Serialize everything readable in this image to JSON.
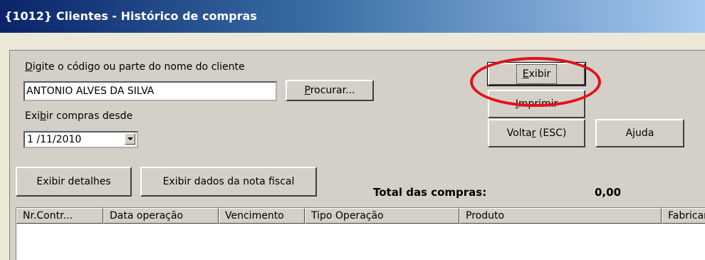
{
  "window": {
    "title": "{1012} Clientes - Histórico de compras"
  },
  "customer_search": {
    "label_prefix": "D",
    "label_rest": "igite o código ou parte do nome do cliente",
    "value": "ANTONIO ALVES DA SILVA",
    "search_prefix": "P",
    "search_rest": "rocurar..."
  },
  "since": {
    "label_pre": "Exi",
    "label_ul": "b",
    "label_post": "ir compras desde",
    "date": "1 /11/2010"
  },
  "actions": {
    "show_ul": "E",
    "show_rest": "xibir",
    "print_ul": "I",
    "print_rest": "mprimir",
    "back_pre": "Volta",
    "back_ul": "r",
    "back_post": " (ESC)",
    "help": "Ajuda"
  },
  "detail_buttons": {
    "details": "Exibir detalhes",
    "invoice": "Exibir dados da nota fiscal"
  },
  "totals": {
    "label": "Total das compras:",
    "value": "0,00"
  },
  "grid": {
    "columns": [
      "Nr.Contr...",
      "Data operação",
      "Vencimento",
      "Tipo Operação",
      "Produto",
      "Fabricant"
    ]
  },
  "colors": {
    "annotation": "#e3101d",
    "titlebar": "#0a246a"
  }
}
